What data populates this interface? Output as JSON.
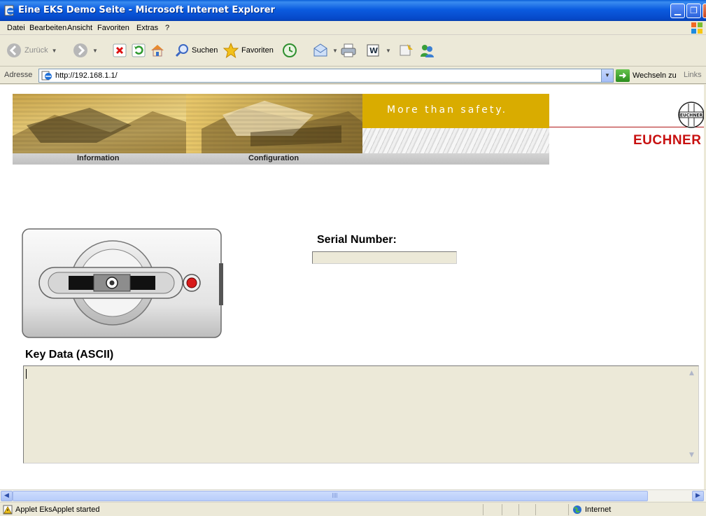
{
  "window": {
    "title": "Eine EKS Demo Seite - Microsoft Internet Explorer"
  },
  "menu": {
    "items": [
      "Datei",
      "Bearbeiten",
      "Ansicht",
      "Favoriten",
      "Extras",
      "?"
    ]
  },
  "toolbar": {
    "back_label": "Zurück",
    "search_label": "Suchen",
    "favorites_label": "Favoriten"
  },
  "address": {
    "label": "Adresse",
    "url": "http://192.168.1.1/",
    "go_label": "Wechseln zu",
    "links_label": "Links"
  },
  "banner": {
    "tagline": "More than safety.",
    "nav": [
      "Information",
      "Configuration"
    ],
    "brand": "EUCHNER",
    "logo_small_text": "EUCHNER",
    "colors": {
      "gold": "#d9ac00",
      "brand_red": "#c81111"
    }
  },
  "content": {
    "serial_label": "Serial Number:",
    "serial_value": "",
    "keydata_label": "Key Data (ASCII)",
    "keydata_value": ""
  },
  "status": {
    "message": "Applet EksApplet started",
    "zone": "Internet"
  }
}
